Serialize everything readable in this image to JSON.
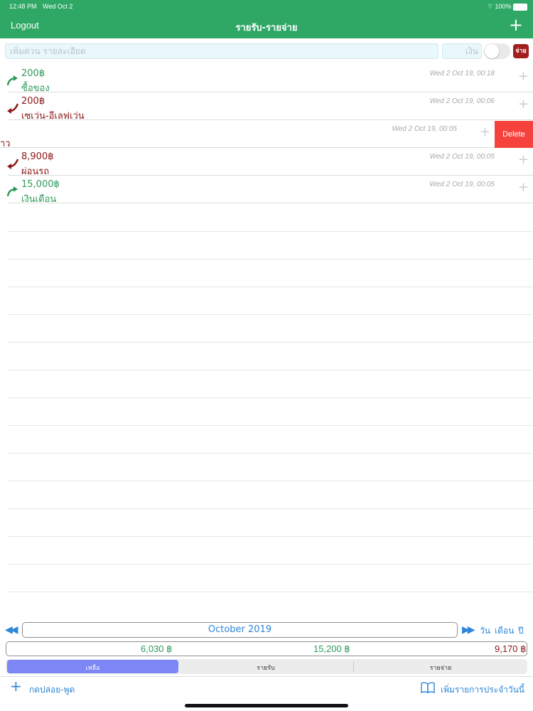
{
  "status": {
    "time": "12:48 PM",
    "date": "Wed Oct 2",
    "battery": "100%"
  },
  "header": {
    "logout": "Logout",
    "title": "รายรับ-รายจ่าย",
    "add": "+"
  },
  "input": {
    "detail_placeholder": "เพิ่มด่วน รายละเอียด",
    "amount_placeholder": "เงิน",
    "type_badge": "จ่าย"
  },
  "transactions": [
    {
      "amount": "200฿",
      "desc": "ซื้อของ",
      "time": "Wed 2 Oct 19, 00:18",
      "type": "income"
    },
    {
      "amount": "200฿",
      "desc": "เซเว่น-อีเลฟเว่น",
      "time": "Wed 2 Oct 19, 00:06",
      "type": "expense"
    },
    {
      "amount": "",
      "desc": "าว",
      "time": "Wed 2 Oct 19, 00:05",
      "type": "expense",
      "swiped": true,
      "delete": "Delete"
    },
    {
      "amount": "8,900฿",
      "desc": "ผ่อนรถ",
      "time": "Wed 2 Oct 19, 00:05",
      "type": "expense"
    },
    {
      "amount": "15,000฿",
      "desc": "เงินเดือน",
      "time": "Wed 2 Oct 19, 00:05",
      "type": "income"
    }
  ],
  "period": {
    "prev": "◀◀",
    "month": "October 2019",
    "next": "▶▶",
    "day": "วัน",
    "monthly": "เดือน",
    "year": "ปี"
  },
  "summary": {
    "balance": "6,030 ฿",
    "income": "15,200 ฿",
    "expense": "9,170 ฿"
  },
  "segments": [
    "เหลือ",
    "รายรับ",
    "รายจ่าย"
  ],
  "footer": {
    "plus": "+",
    "hold": "กดปล่อย-พูด",
    "add_daily": "เพิ่มรายการประจำวันนี้"
  },
  "colors": {
    "header": "#2fa866",
    "income": "#2f9a5a",
    "expense": "#8d1717",
    "accent": "#2e86d8",
    "delete": "#f6423d"
  }
}
